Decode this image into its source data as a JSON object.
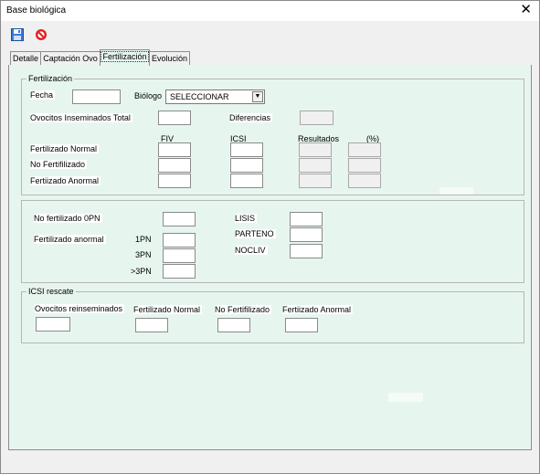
{
  "window": {
    "title": "Base biológica"
  },
  "toolbar": {
    "save_icon": "save-icon",
    "cancel_icon": "cancel-icon"
  },
  "tabs": [
    {
      "label": "Detalle"
    },
    {
      "label": "Captación Ovo"
    },
    {
      "label": "Fertilización"
    },
    {
      "label": "Evolución"
    }
  ],
  "fertilizacion": {
    "group_title": "Fertilización",
    "fecha_label": "Fecha",
    "fecha_value": "",
    "biologo_label": "Biólogo",
    "biologo_value": "SELECCIONAR",
    "ovocitos_label": "Ovocitos Inseminados Total",
    "diferencias_label": "Diferencias",
    "col_fiv": "FIV",
    "col_icsi": "ICSI",
    "col_resultados": "Resultados",
    "col_pct": "(%)",
    "rows": [
      "Fertilizado Normal",
      "No Fertifilizado",
      "Fertiizado Anormal"
    ]
  },
  "section2": {
    "no_fertilizado_label": "No fertilizado 0PN",
    "fertilizado_anormal_label": "Fertilizado anormal",
    "pn_labels": [
      "1PN",
      "3PN",
      ">3PN"
    ],
    "right_labels": [
      "LISIS",
      "PARTENO",
      "NOCLIV"
    ]
  },
  "icsi": {
    "group_title": "ICSI rescate",
    "labels": [
      "Ovocitos reinseminados",
      "Fertilizado Normal",
      "No Fertifilizado",
      "Fertiizado Anormal"
    ]
  }
}
